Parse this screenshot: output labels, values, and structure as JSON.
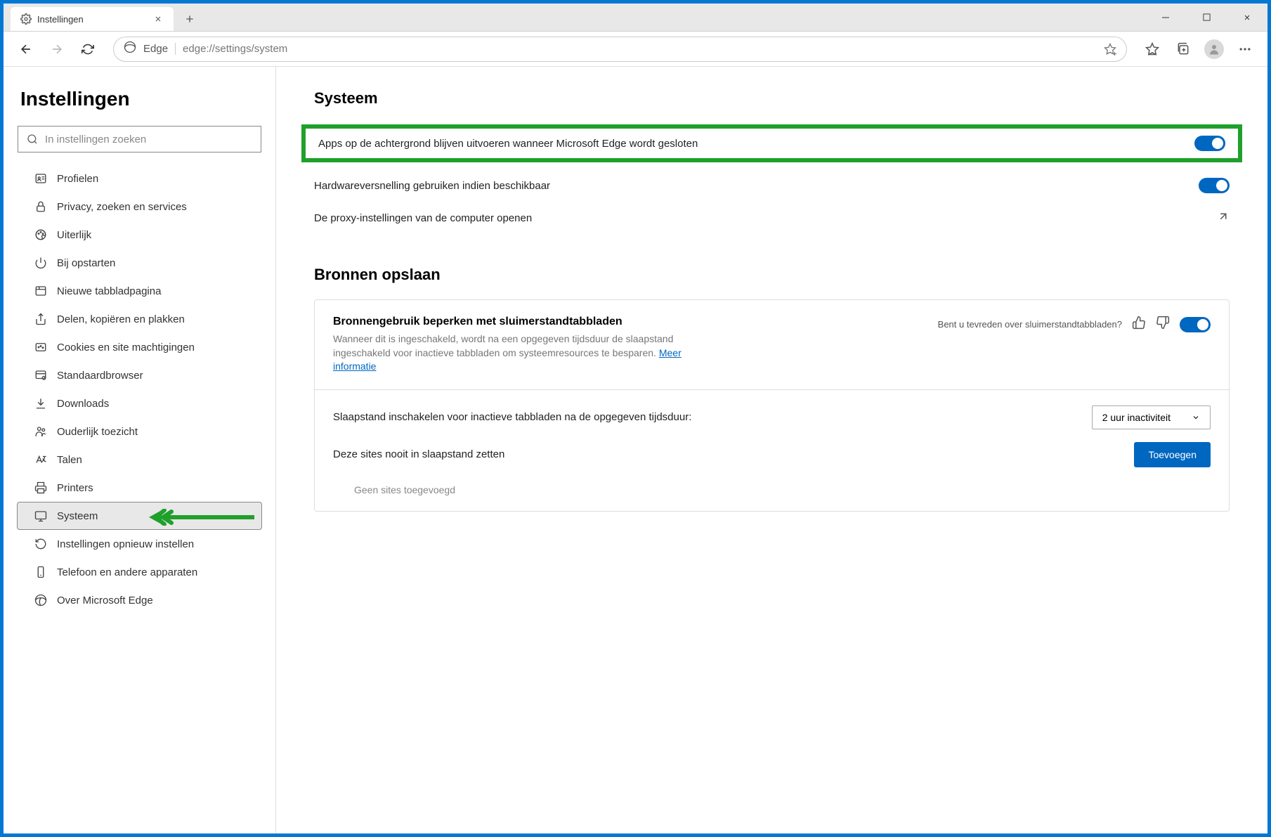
{
  "tab": {
    "title": "Instellingen"
  },
  "address": {
    "prefix": "Edge",
    "url": "edge://settings/system"
  },
  "sidebar": {
    "heading": "Instellingen",
    "search_placeholder": "In instellingen zoeken",
    "items": [
      {
        "label": "Profielen",
        "icon": "profile"
      },
      {
        "label": "Privacy, zoeken en services",
        "icon": "lock"
      },
      {
        "label": "Uiterlijk",
        "icon": "appearance"
      },
      {
        "label": "Bij opstarten",
        "icon": "power"
      },
      {
        "label": "Nieuwe tabbladpagina",
        "icon": "newtab"
      },
      {
        "label": "Delen, kopiëren en plakken",
        "icon": "share"
      },
      {
        "label": "Cookies en site machtigingen",
        "icon": "cookie"
      },
      {
        "label": "Standaardbrowser",
        "icon": "default"
      },
      {
        "label": "Downloads",
        "icon": "download"
      },
      {
        "label": "Ouderlijk toezicht",
        "icon": "family"
      },
      {
        "label": "Talen",
        "icon": "language"
      },
      {
        "label": "Printers",
        "icon": "printer"
      },
      {
        "label": "Systeem",
        "icon": "system",
        "active": true
      },
      {
        "label": "Instellingen opnieuw instellen",
        "icon": "reset"
      },
      {
        "label": "Telefoon en andere apparaten",
        "icon": "phone"
      },
      {
        "label": "Over Microsoft Edge",
        "icon": "edge"
      }
    ]
  },
  "main": {
    "heading": "Systeem",
    "row_bgapps": "Apps op de achtergrond blijven uitvoeren wanneer Microsoft Edge wordt gesloten",
    "row_hw": "Hardwareversnelling gebruiken indien beschikbaar",
    "row_proxy": "De proxy-instellingen van de computer openen",
    "section2_heading": "Bronnen opslaan",
    "sleep_title": "Bronnengebruik beperken met sluimerstandtabbladen",
    "sleep_desc": "Wanneer dit is ingeschakeld, wordt na een opgegeven tijdsduur de slaapstand ingeschakeld voor inactieve tabbladen om systeemresources te besparen. ",
    "sleep_link": "Meer informatie",
    "feedback_q": "Bent u tevreden over sluimerstandtabbladen?",
    "sleep_after_label": "Slaapstand inschakelen voor inactieve tabbladen na de opgegeven tijdsduur:",
    "sleep_after_value": "2 uur inactiviteit",
    "never_sleep_label": "Deze sites nooit in slaapstand zetten",
    "add_button": "Toevoegen",
    "no_sites": "Geen sites toegevoegd"
  }
}
